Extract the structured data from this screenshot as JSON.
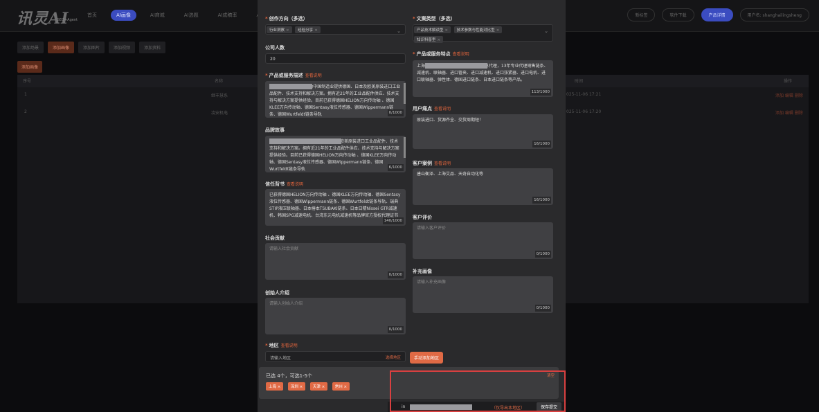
{
  "topbar": {
    "logo": "讯灵AI",
    "logo_sub": "GEO+Agent",
    "nav": [
      "首页",
      "AI画像",
      "AI商城",
      "AI选题",
      "AI成稿率",
      "AI智能体"
    ],
    "right": [
      "新标签",
      "软件下载",
      "产品详情",
      "用户名: shanghailingsheng"
    ]
  },
  "tabs": [
    "添加场景",
    "添加画像",
    "添加图片",
    "添加视频",
    "添加资料"
  ],
  "add_label": "添加画像",
  "table": {
    "headers": [
      "序号",
      "名称",
      "时间",
      "操作"
    ],
    "rows": [
      {
        "no": "1",
        "name": "继丰慧系",
        "time": "025-11-06 17:21",
        "acts": "添加 编辑 删除"
      },
      {
        "no": "2",
        "name": "凌安机电",
        "time": "025-11-06 17:20",
        "acts": "添加 编辑 删除"
      }
    ]
  },
  "form": {
    "direction": {
      "label": "创作方向（多选）",
      "tags": [
        "行业洞察",
        "经验分享"
      ]
    },
    "doc_type": {
      "label": "文案类型（多选）",
      "tags": [
        "产品技术解读型",
        "技术参数与性能对比型",
        "知识科普型"
      ]
    },
    "company_size": {
      "label": "公司人数",
      "value": "20"
    },
    "features": {
      "label": "产品或服务特点",
      "hint": "查看说明",
      "text": "上海                    艾司匹茨，德本特进口品牌中国总代理，13年专业代理销售链条、减速机、联轴器、进口管夹、进口减速机、进口张紧器、进口电机、进口联轴器、弹性体、德国进口链条、日本进口链条等产品。",
      "count": "113/1000"
    },
    "desc": {
      "label": "产品或服务描述",
      "hint": "查看说明",
      "text": "            公司（LSPTC），专注为中国制造业提供德国、日本及欧美原装进口工业品配件、技术支持和解决方案。拥有近21年的工业品配件供应、技术支持与解决方案提供经验。目前已获得德国HELION万向传动轴 、德国KLEE万向传动轴、德国Sentasy液位传感器、德国Wippermann链条、德国Wurtfeldt链条导轨",
      "count": "0/1000"
    },
    "pain": {
      "label": "用户痛点",
      "hint": "查看说明",
      "text": "原装进口、货源齐全、交货周期短！",
      "count": "16/1000"
    },
    "story": {
      "label": "品牌故事",
      "text": "                         ，专注为中国制造业提供德国、日本及欧美原装进口工业品配件、技术支持和解决方案。拥有近21年的工业品配件供应、技术支持与解决方案提供经验。目前已获得德国HELION万向传动轴 、德国KLEE万向传动轴、德国Sentasy液位传感器、德国Wippermann链条、德国Wurtfeldt链条导轨",
      "count": "6/1000"
    },
    "cases": {
      "label": "客户案例",
      "hint": "查看说明",
      "text": "唐山衡泽、上海艾品、天奇自动化等",
      "count": "16/1000"
    },
    "trust": {
      "label": "信任背书",
      "hint": "查看说明",
      "text": "已获得德国HELION万向传动轴 、德国KLEE万向传动轴、德国Sentasy液位传感器、德国Wippermann链条、德国Wurtfeldt链条导轨、瑞典STIP液压联轴器、日本椿本TSUBAKI链条、日本日精Nissei GTR减速机、韩国SPG减速电机、台湾东元电机减速机等品牌官方授权代理证书",
      "count": "140/1000"
    },
    "review": {
      "label": "客户评价",
      "placeholder": "请输入客户评价",
      "count": "0/1000"
    },
    "social": {
      "label": "社会贡献",
      "placeholder": "请输入社会贡献",
      "count": "0/1000"
    },
    "profile": {
      "label": "补充画像",
      "placeholder": "请输入补充画像",
      "count": "0/1000"
    },
    "founder": {
      "label": "创始人介绍",
      "placeholder": "请输入创始人介绍",
      "count": "0/1000"
    },
    "region": {
      "label": "地区",
      "hint": "查看说明",
      "placeholder": "请输入地区",
      "pick": "选择地区",
      "add_btn": "手动添加地区",
      "summary": "已选 4个，可选1-5个",
      "tags": [
        "上海",
        "深圳",
        "天津",
        "常州"
      ]
    },
    "clear": "清空",
    "footer": {
      "prefix": "in",
      "note": "（仅导出本地区）",
      "save": "保存提交"
    }
  },
  "colors": {
    "accent": "#e06a45",
    "brand": "#3b4cc0",
    "highlight": "#d94040"
  }
}
